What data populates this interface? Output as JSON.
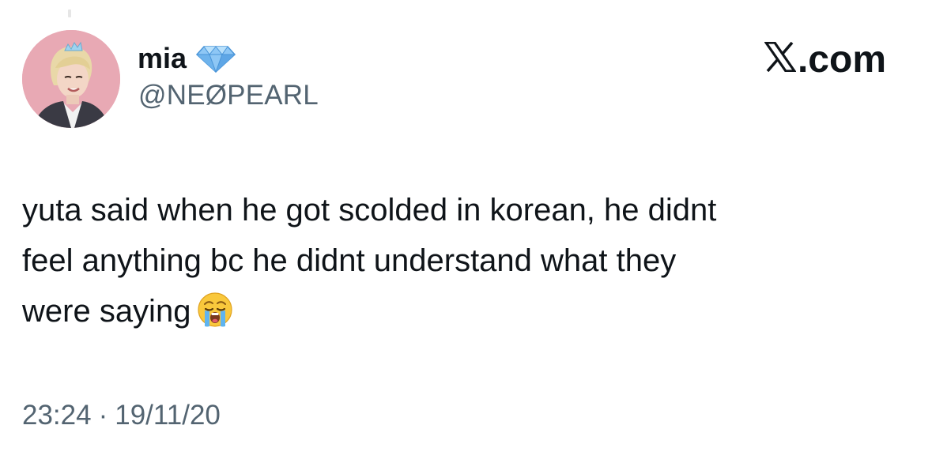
{
  "author": {
    "display_name": "mia",
    "handle": "@NEØPEARL",
    "avatar": "profile-photo",
    "badge_icon": "gem-icon"
  },
  "brand": {
    "label": ".com",
    "logo_icon": "x-logo-icon"
  },
  "tweet": {
    "lines": [
      "yuta said when he got scolded in korean, he didnt",
      "feel anything bc he didnt understand what they",
      "were saying"
    ],
    "emoji": "loudly-crying-face-icon"
  },
  "meta": {
    "time": "23:24",
    "separator": "·",
    "date": "19/11/20"
  },
  "colors": {
    "text": "#0f1419",
    "secondary": "#536471",
    "avatar_background": "#e7a6b1",
    "gem": "#8ec7f5"
  }
}
